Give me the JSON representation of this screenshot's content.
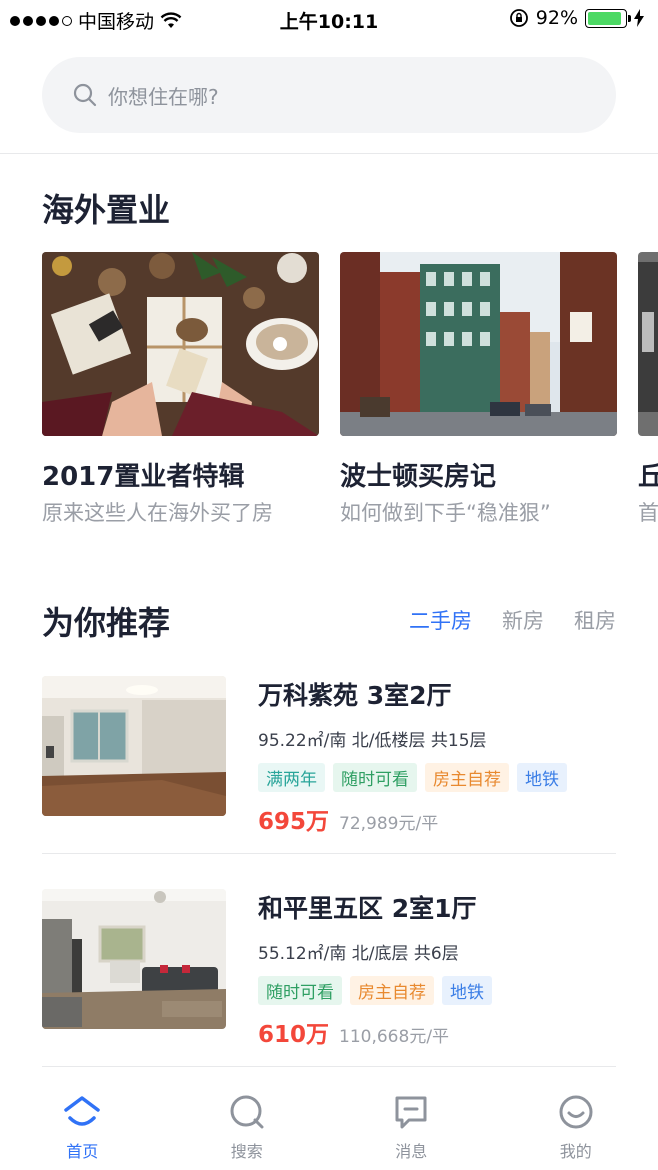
{
  "status_bar": {
    "carrier": "中国移动",
    "time": "上午10:11",
    "battery": "92%",
    "battery_level": 0.92
  },
  "search": {
    "placeholder": "你想住在哪?"
  },
  "overseas": {
    "title": "海外置业",
    "cards": [
      {
        "title": "2017置业者特辑",
        "subtitle": "原来这些人在海外买了房"
      },
      {
        "title": "波士顿买房记",
        "subtitle": "如何做到下手“稳准狠”"
      },
      {
        "title": "丘",
        "subtitle": "首"
      }
    ]
  },
  "recommend": {
    "title": "为你推荐",
    "tabs": [
      {
        "label": "二手房",
        "active": true
      },
      {
        "label": "新房",
        "active": false
      },
      {
        "label": "租房",
        "active": false
      }
    ]
  },
  "listings": [
    {
      "title": "万科紫苑 3室2厅",
      "meta": "95.22㎡/南 北/低楼层 共15层",
      "tags": [
        "满两年",
        "随时可看",
        "房主自荐",
        "地铁"
      ],
      "price": "695万",
      "unit_price": "72,989元/平"
    },
    {
      "title": "和平里五区 2室1厅",
      "meta": "55.12㎡/南 北/底层 共6层",
      "tags": [
        "随时可看",
        "房主自荐",
        "地铁"
      ],
      "price": "610万",
      "unit_price": "110,668元/平"
    }
  ],
  "tag_colors": {
    "满两年": {
      "bg": "#e9f7f5",
      "fg": "#2aa59a"
    },
    "随时可看": {
      "bg": "#e6f6ee",
      "fg": "#2f9f63"
    },
    "房主自荐": {
      "bg": "#fff2e4",
      "fg": "#e8892f"
    },
    "地铁": {
      "bg": "#e8f1fd",
      "fg": "#3b7ee6"
    }
  },
  "bottom_nav": [
    {
      "label": "首页",
      "icon": "home-icon",
      "active": true
    },
    {
      "label": "搜索",
      "icon": "search-icon",
      "active": false
    },
    {
      "label": "消息",
      "icon": "message-icon",
      "active": false
    },
    {
      "label": "我的",
      "icon": "profile-icon",
      "active": false
    }
  ],
  "colors": {
    "accent": "#3072f6",
    "price": "#f3473a"
  }
}
